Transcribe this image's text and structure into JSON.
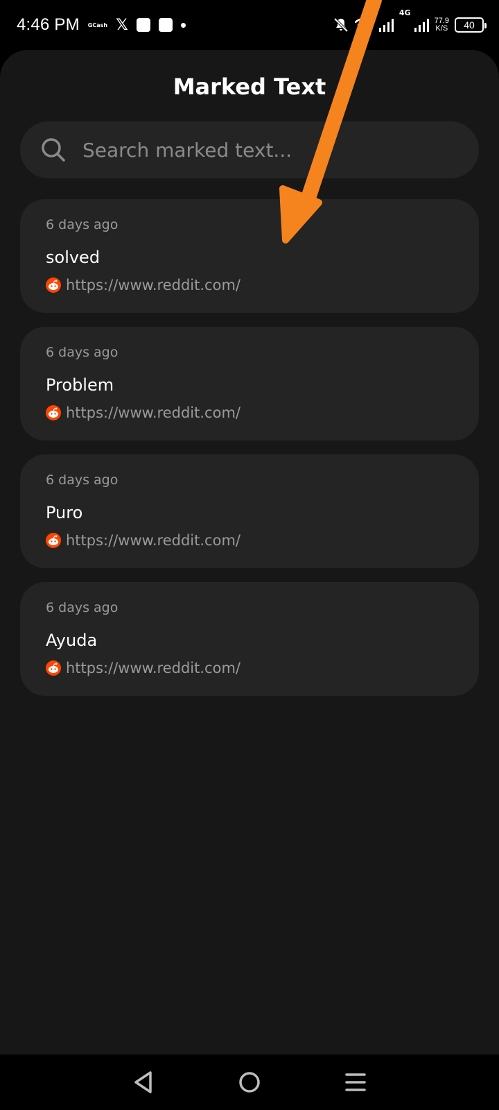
{
  "status_bar": {
    "time": "4:46 PM",
    "gcash_label": "GCash",
    "x_logo": "𝕏",
    "net_speed_value": "77.9",
    "net_speed_unit": "K/S",
    "network_type": "4G",
    "battery_level": "40"
  },
  "header": {
    "title": "Marked Text"
  },
  "search": {
    "placeholder": "Search marked text..."
  },
  "items": [
    {
      "time": "6 days ago",
      "text": "solved",
      "url": "https://www.reddit.com/"
    },
    {
      "time": "6 days ago",
      "text": "Problem",
      "url": "https://www.reddit.com/"
    },
    {
      "time": "6 days ago",
      "text": "Puro",
      "url": "https://www.reddit.com/"
    },
    {
      "time": "6 days ago",
      "text": "Ayuda",
      "url": "https://www.reddit.com/"
    }
  ],
  "colors": {
    "background": "#171717",
    "card": "#242424",
    "annotation_arrow": "#F5841F",
    "reddit_orange": "#FF4500"
  },
  "icons": {
    "search": "search-icon",
    "source": "reddit-icon",
    "back": "back-triangle-icon",
    "home": "home-circle-icon",
    "recents": "menu-lines-icon"
  }
}
